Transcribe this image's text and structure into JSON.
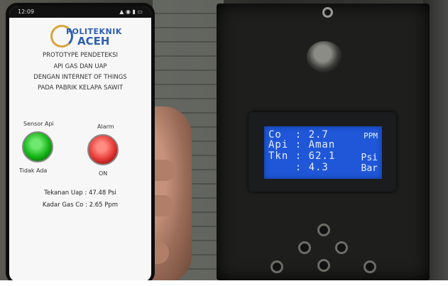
{
  "phone": {
    "status_time": "12:09",
    "status_icons": "▲ ◉ ▮ ▭",
    "logo_line1": "POLITEKNIK",
    "logo_line2": "ACEH",
    "title_lines": [
      "PROTOTYPE PENDETEKSI",
      "API GAS DAN UAP",
      "DENGAN INTERNET OF THINGS",
      "PADA PABRIK KELAPA SAWIT"
    ],
    "sensor_label": "Sensor Api",
    "sensor_state": "Tidak Ada",
    "alarm_label": "Alarm",
    "alarm_state": "ON",
    "pressure_reading": "Tekanan Uap : 47.48 Psi",
    "gas_reading": "Kadar Gas Co : 2.65 Ppm"
  },
  "lcd": {
    "rows": [
      {
        "text": "Co  : 2.7",
        "unit": "PPM"
      },
      {
        "text": "Api : Aman",
        "unit": ""
      },
      {
        "text": "Tkn : 62.1",
        "unit": "Psi"
      },
      {
        "text": "    : 4.3",
        "unit": "Bar"
      }
    ]
  },
  "colors": {
    "lcd_bg": "#1f57d8",
    "lamp_green": "#16b516",
    "lamp_red": "#e53935",
    "logo_blue": "#2d5fb3"
  }
}
